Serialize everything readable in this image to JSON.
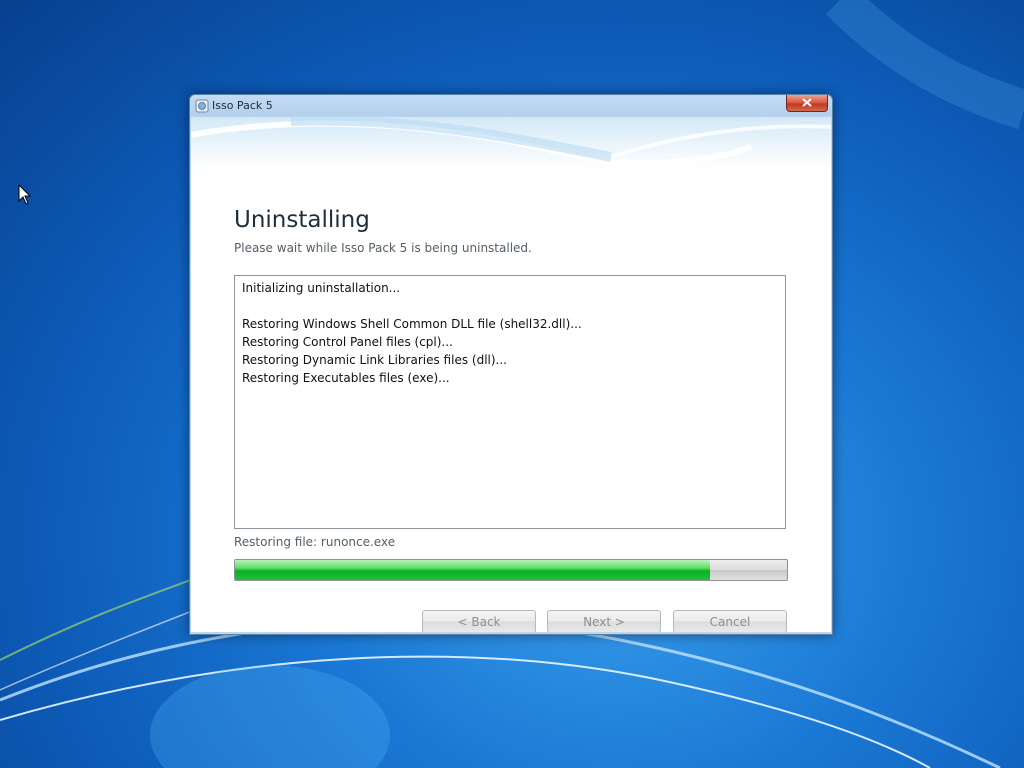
{
  "window": {
    "title": "Isso Pack 5"
  },
  "page": {
    "heading": "Uninstalling",
    "subheading": "Please wait while Isso Pack 5 is being uninstalled."
  },
  "log": {
    "lines": [
      "Initializing uninstallation...",
      "",
      "Restoring Windows Shell Common DLL file (shell32.dll)...",
      "Restoring Control Panel files (cpl)...",
      "Restoring Dynamic Link Libraries files (dll)...",
      "Restoring Executables files (exe)..."
    ]
  },
  "status": {
    "text": "Restoring file: runonce.exe",
    "progress_fraction": 0.86,
    "progress_color": "#06b025"
  },
  "buttons": {
    "back": "< Back",
    "next": "Next >",
    "cancel": "Cancel"
  },
  "icons": {
    "title_icon": "installer-app-icon",
    "close_icon": "close-icon",
    "cursor": "mouse-pointer"
  }
}
